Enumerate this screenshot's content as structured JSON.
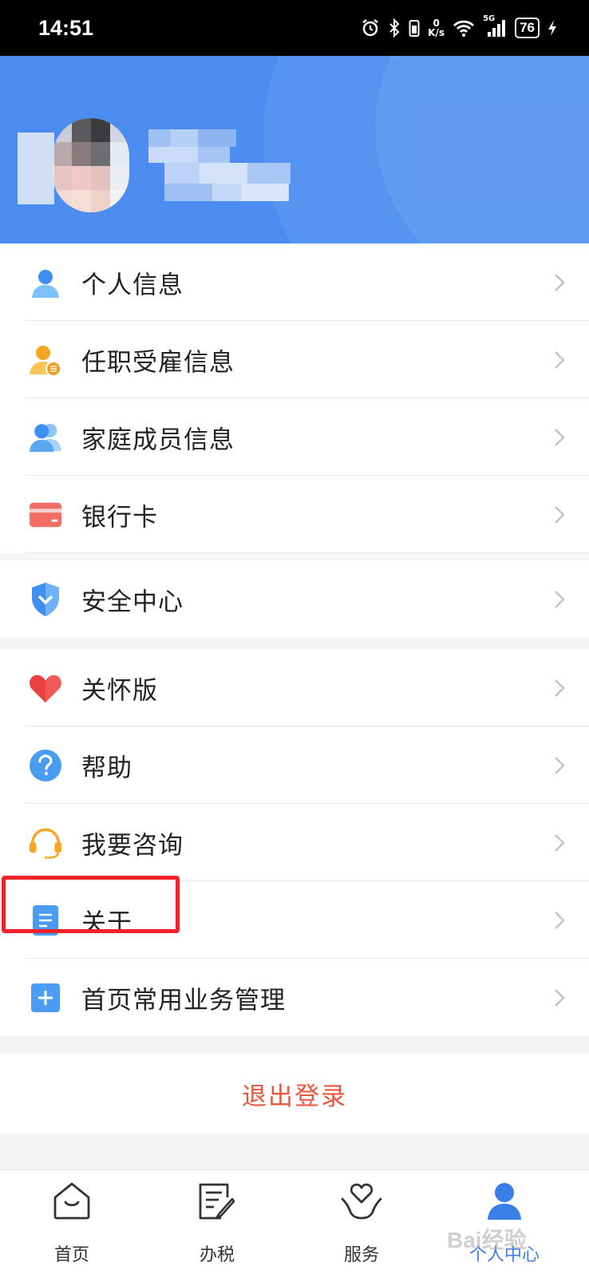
{
  "status_bar": {
    "time": "14:51",
    "net_speed_value": "0",
    "net_speed_unit": "K/s",
    "signal_label": "5G",
    "battery": "76"
  },
  "profile": {
    "avatar": "avatar (pixelated)",
    "name": ""
  },
  "menu_group_1": [
    {
      "label": "个人信息",
      "icon": "person-icon"
    },
    {
      "label": "任职受雇信息",
      "icon": "employee-icon"
    },
    {
      "label": "家庭成员信息",
      "icon": "family-icon"
    },
    {
      "label": "银行卡",
      "icon": "bank-card-icon"
    }
  ],
  "menu_group_2": [
    {
      "label": "安全中心",
      "icon": "shield-icon"
    }
  ],
  "menu_group_3": [
    {
      "label": "关怀版",
      "icon": "heart-icon"
    },
    {
      "label": "帮助",
      "icon": "help-icon"
    },
    {
      "label": "我要咨询",
      "icon": "headset-icon"
    },
    {
      "label": "关于",
      "icon": "document-icon"
    },
    {
      "label": "首页常用业务管理",
      "icon": "plus-icon"
    }
  ],
  "logout_label": "退出登录",
  "tabs": [
    {
      "label": "首页",
      "icon": "home-icon"
    },
    {
      "label": "办税",
      "icon": "tax-icon"
    },
    {
      "label": "服务",
      "icon": "service-icon"
    },
    {
      "label": "个人中心",
      "icon": "profile-icon",
      "active": true
    }
  ],
  "watermark": "Bai经验",
  "colors": {
    "header_blue": "#4b8cf0",
    "accent_blue": "#3a7ee8",
    "logout_red": "#e8573d",
    "highlight_red": "#f0232a"
  }
}
